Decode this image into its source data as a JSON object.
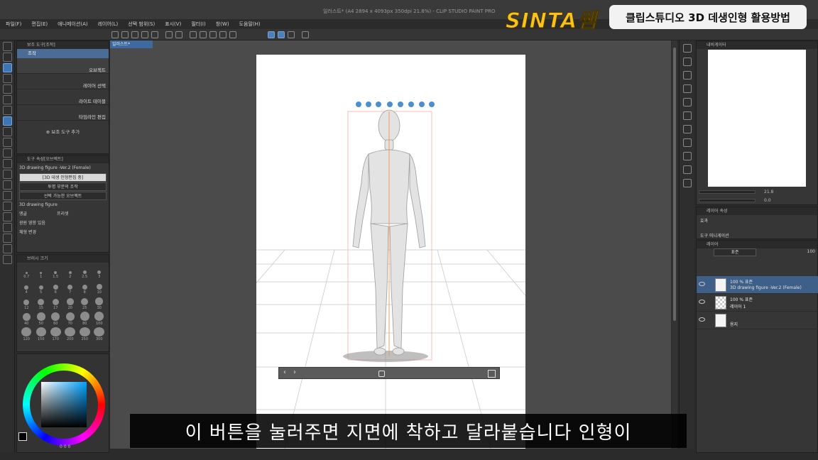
{
  "window": {
    "title": "일러스트* (A4 2894 x 4093px 350dpi 21.8%) - CLIP STUDIO PAINT PRO"
  },
  "overlay": {
    "brand": "SINTA쌤",
    "topic": "클립스튜디오 3D 데생인형 활용방법",
    "subtitle": "이 버튼을 눌러주면 지면에 착하고 달라붙습니다 인형이"
  },
  "menu": {
    "items": [
      "파일(F)",
      "편집(E)",
      "애니메이션(A)",
      "레이어(L)",
      "선택 범위(S)",
      "표시(V)",
      "필터(I)",
      "창(W)",
      "도움말(H)"
    ]
  },
  "subtool_panel": {
    "header": "보조 도구[조작]",
    "tab": "조작",
    "items": [
      "오브젝트",
      "레이어 선택",
      "라이트 테이블",
      "타임라인 편집"
    ],
    "add_label": "보조 도구 추가"
  },
  "tool_property": {
    "header": "도구 속성[오브젝트]",
    "object_name": "3D drawing figure -Ver.2 (Female)",
    "edit_state": "[3D 데생 인형편집 중]",
    "transparent_option": "투명 부분의 조작",
    "selectable_option": "선택 가능한 오브젝트",
    "layer_item": "3D drawing figure",
    "angle_label": "앵글",
    "preset_label": "프리셋",
    "lighting_label": "광원 영향 있음",
    "body_shape_label": "체형 변경"
  },
  "brush_size": {
    "header": "브러시 크기",
    "sizes": [
      "0.7",
      "1",
      "1.5",
      "2",
      "2.5",
      "3",
      "4",
      "5",
      "6",
      "7",
      "8",
      "10",
      "12",
      "15",
      "17",
      "20",
      "25",
      "30",
      "40",
      "50",
      "60",
      "70",
      "80",
      "100",
      "120",
      "150",
      "170",
      "200",
      "250",
      "300"
    ]
  },
  "color": {
    "values": [
      "0",
      "0",
      "0"
    ]
  },
  "canvas": {
    "tab_label": "일러스트*"
  },
  "navigator": {
    "header": "내비게이터",
    "zoom": "21.8",
    "rotation": "0.0"
  },
  "layer_property": {
    "header": "레이어 속성",
    "effect_label": "효과",
    "ruler_label": "도구 미니게이션"
  },
  "layers": {
    "header": "레이어",
    "blend_mode": "표준",
    "opacity": "100",
    "rows": [
      {
        "line1": "100 % 표준",
        "line2": "3D drawing figure -Ver.2 (Female)"
      },
      {
        "line1": "100 % 표준",
        "line2": "레이어 1"
      },
      {
        "line1": "",
        "line2": "용지"
      }
    ]
  },
  "colors": {
    "accent": "#3e6aa0",
    "brand_yellow": "#f6c21b"
  }
}
